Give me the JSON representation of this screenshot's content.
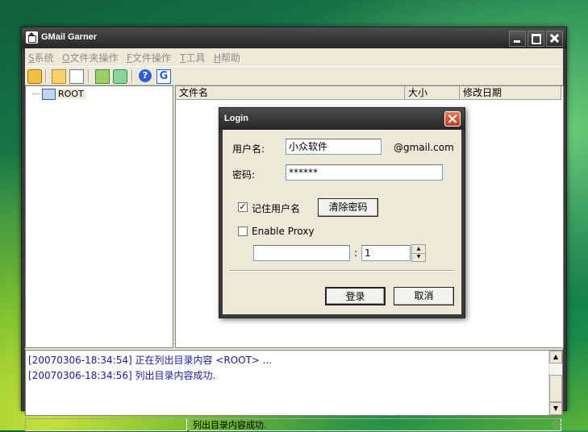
{
  "window": {
    "title": "GMail Garner"
  },
  "menu": [
    {
      "key": "S",
      "label": "系统"
    },
    {
      "key": "O",
      "label": "文件夹操作"
    },
    {
      "key": "F",
      "label": "文件操作"
    },
    {
      "key": "T",
      "label": "工具"
    },
    {
      "key": "H",
      "label": "帮助"
    }
  ],
  "toolbar": {
    "icons": [
      "key-icon",
      "folder-open-icon",
      "document-icon",
      "folder-up-icon",
      "refresh-icon",
      "help-icon",
      "gmail-g-icon"
    ],
    "g_glyph": "G",
    "help_glyph": "?"
  },
  "tree": {
    "root_label": "ROOT"
  },
  "list": {
    "columns": [
      "文件名",
      "大小",
      "修改日期"
    ]
  },
  "log": [
    "[20070306-18:34:54] 正在列出目录内容 <ROOT> ...",
    "[20070306-18:34:56] 列出目录内容成功."
  ],
  "status": {
    "message": "列出目录内容成功."
  },
  "dialog": {
    "title": "Login",
    "username_label": "用户名:",
    "username_value": "小众软件",
    "domain": "@gmail.com",
    "password_label": "密码:",
    "password_value": "******",
    "remember_label": "记住用户名",
    "remember_checked": true,
    "clear_password_label": "清除密码",
    "proxy_label": "Enable Proxy",
    "proxy_checked": false,
    "proxy_host": "",
    "proxy_separator": ":",
    "proxy_port": "1",
    "login_label": "登录",
    "cancel_label": "取消"
  },
  "colors": {
    "log_text": "#1a1a9a",
    "dialog_close": "#c0391f",
    "menu_disabled": "#8e8e8e"
  }
}
